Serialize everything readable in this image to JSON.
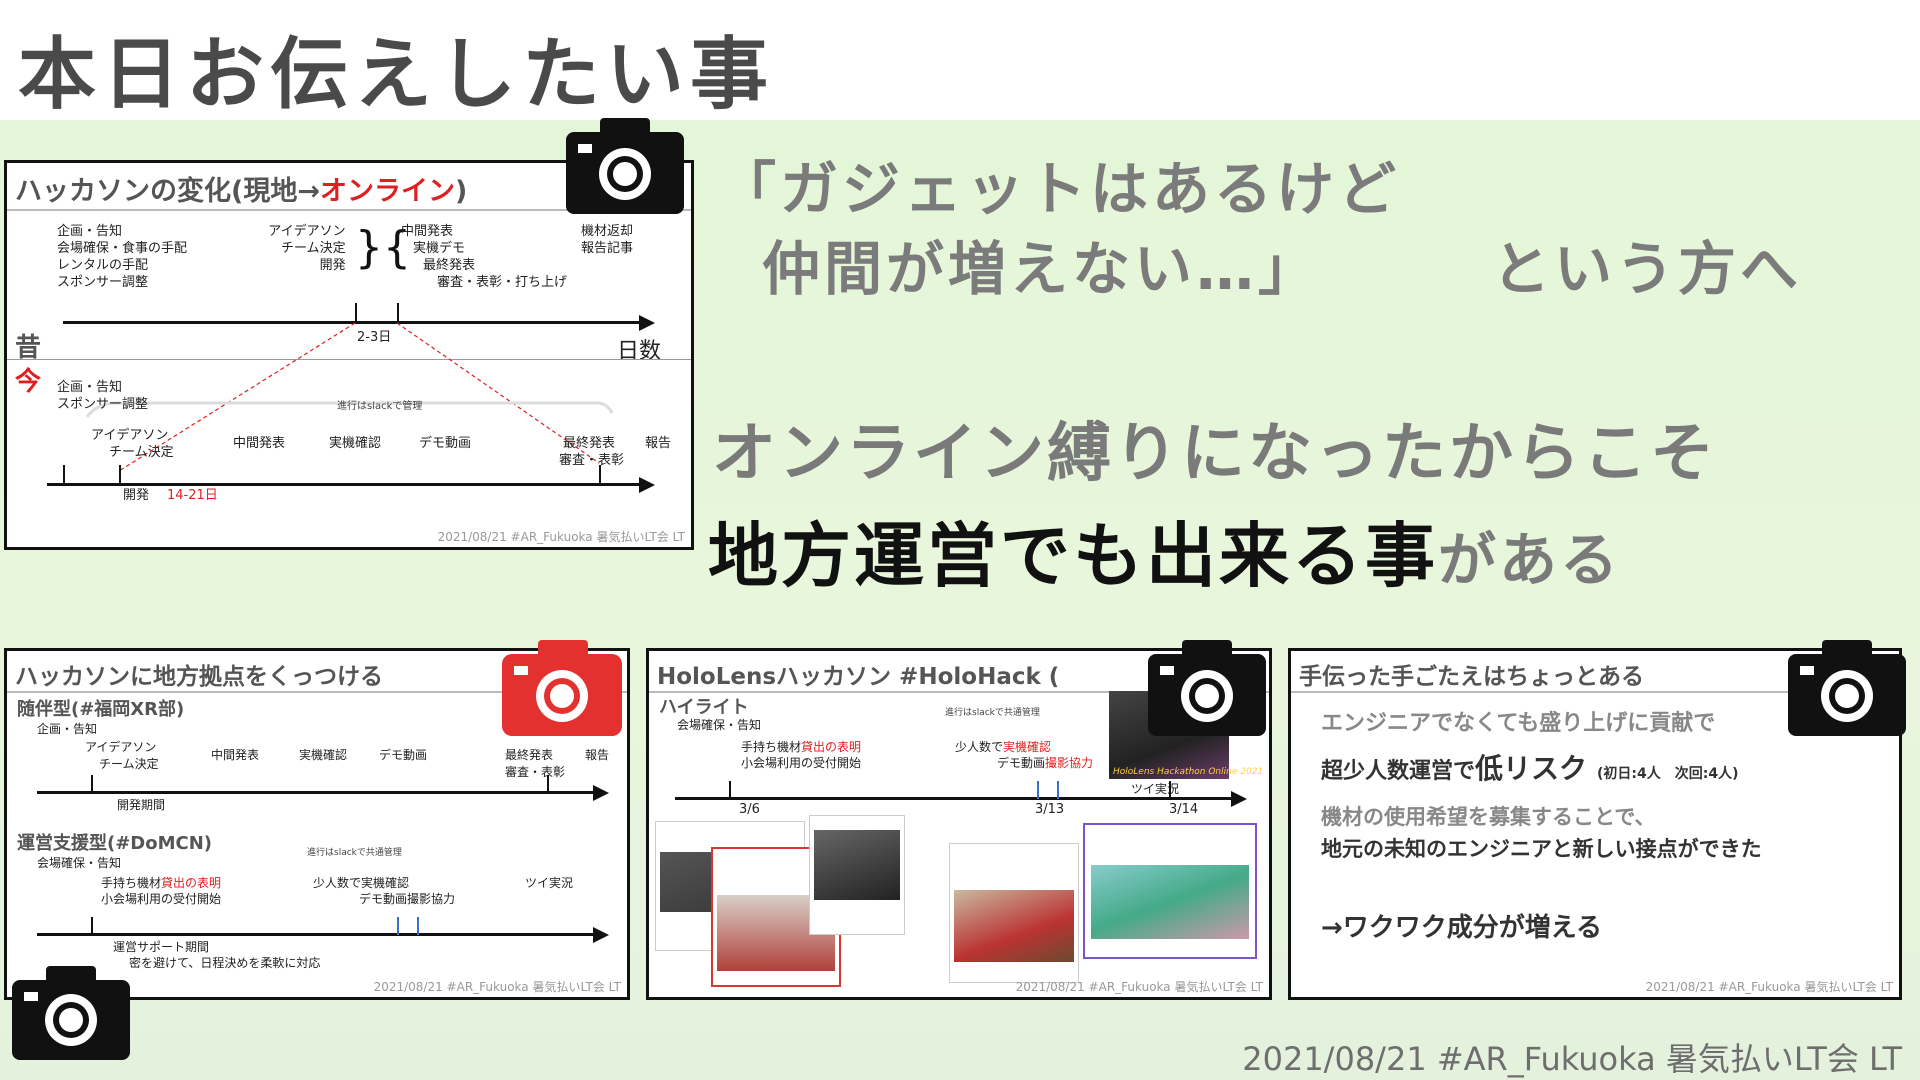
{
  "page_title": "本日お伝えしたい事",
  "quote": {
    "line1": "「ガジェットはあるけど",
    "line2": "仲間が増えない…」",
    "target": "という方へ"
  },
  "message": {
    "line1": "オンライン縛りになったからこそ",
    "line2_bold": "地方運営でも出来る事",
    "line2_tail": "がある"
  },
  "footer": "2021/08/21 #AR_Fukuoka 暑気払いLT会 LT",
  "slide1": {
    "title_prefix": "ハッカソンの変化(現地→",
    "title_accent": "オンライン",
    "title_suffix": ")",
    "past_label": "昔",
    "now_label": "今",
    "past_items": {
      "prep": [
        "企画・告知",
        "会場確保・食事の手配",
        "レンタルの手配",
        "スポンサー調整"
      ],
      "day1": [
        "アイデアソン",
        "チーム決定",
        "開発"
      ],
      "day2": [
        "中間発表",
        "実機デモ",
        "最終発表",
        "審査・表彰・打ち上げ"
      ],
      "after": [
        "機材返却",
        "報告記事"
      ]
    },
    "past_duration": "2-3日",
    "axis_label": "日数",
    "now_items": {
      "prep": [
        "企画・告知",
        "スポンサー調整"
      ],
      "slack_note": "進行はslackで管理",
      "ideathon": [
        "アイデアソン",
        "チーム決定"
      ],
      "midterm": "中間発表",
      "device_check": "実機確認",
      "demo_video": "デモ動画",
      "final": [
        "最終発表",
        "審査・表彰"
      ],
      "report": "報告",
      "dev": "開発",
      "duration": "14-21日"
    },
    "footer": "2021/08/21 #AR_Fukuoka 暑気払いLT会 LT"
  },
  "slide2": {
    "title": "ハッカソンに地方拠点をくっつける",
    "section1": "随伴型(#福岡XR部)",
    "s1_items": {
      "plan": "企画・告知",
      "ideathon": [
        "アイデアソン",
        "チーム決定"
      ],
      "midterm": "中間発表",
      "device_check": "実機確認",
      "demo_video": "デモ動画",
      "final": [
        "最終発表",
        "審査・表彰"
      ],
      "report": "報告",
      "period": "開発期間"
    },
    "section2": "運営支援型(#DoMCN)",
    "s2_items": {
      "venue": "会場確保・告知",
      "slack_note": "進行はslackで共通管理",
      "lend_prefix": "手持ち機材",
      "lend_accent": "貸出の表明",
      "small_venue": "小会場利用の受付開始",
      "small_team_prefix": "少人数で",
      "small_team_accent": "実機確認",
      "demo_prefix": "デモ動画",
      "demo_accent": "撮影協力",
      "tweet_live": "ツイ実況",
      "support": "運営サポート期間",
      "support_note": "密を避けて、日程決めを柔軟に対応"
    },
    "footer": "2021/08/21 #AR_Fukuoka 暑気払いLT会 LT"
  },
  "slide3": {
    "title": "HoloLensハッカソン #HoloHack (",
    "section": "ハイライト",
    "items": {
      "venue": "会場確保・告知",
      "slack_note": "進行はslackで共通管理",
      "lend_prefix": "手持ち機材",
      "lend_accent": "貸出の表明",
      "small_venue": "小会場利用の受付開始",
      "small_team_prefix": "少人数で",
      "small_team_accent": "実機確認",
      "demo_prefix": "デモ動画",
      "demo_accent": "撮影協力",
      "tweet_live": "ツイ実況"
    },
    "dates": [
      "3/6",
      "3/13",
      "3/14"
    ],
    "banner": "HoloLens Hackathon Online 2021",
    "footer": "2021/08/21 #AR_Fukuoka 暑気払いLT会 LT"
  },
  "slide4": {
    "title": "手伝った手ごたえはちょっとある",
    "line1": "エンジニアでなくても盛り上げに貢献で",
    "line2_prefix": "超少人数運営で",
    "line2_strong": "低リスク",
    "line2_note": "(初日:4人　次回:4人)",
    "line3": "機材の使用希望を募集することで、",
    "line4": "地元の未知のエンジニアと新しい接点ができた",
    "line5": "→ワクワク成分が増える",
    "footer": "2021/08/21 #AR_Fukuoka 暑気払いLT会 LT"
  },
  "colors": {
    "accent_red": "#e02020",
    "bg_green": "#e4f6d8",
    "title_gray": "#4a4a4a"
  },
  "icons": [
    "camera-icon"
  ]
}
